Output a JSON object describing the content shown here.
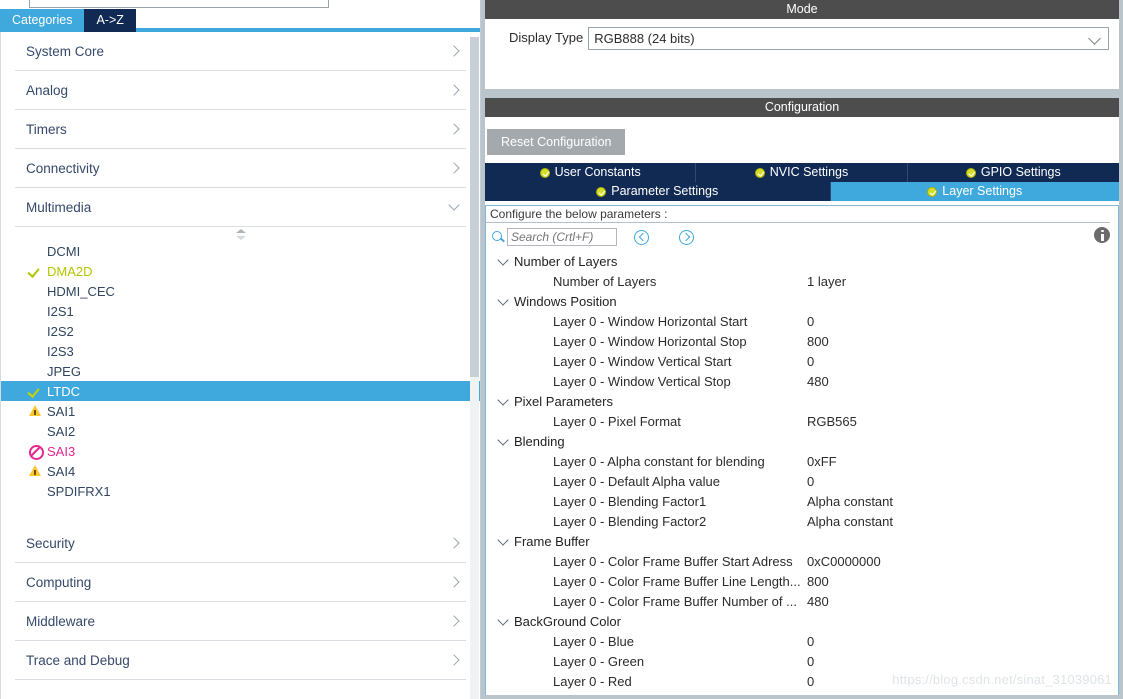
{
  "left_panel": {
    "search_box": {
      "value": "",
      "placeholder": ""
    },
    "tabs": [
      {
        "label": "Categories",
        "active": true
      },
      {
        "label": "A->Z",
        "active": false
      }
    ],
    "categories": [
      {
        "label": "System Core",
        "expanded": false
      },
      {
        "label": "Analog",
        "expanded": false
      },
      {
        "label": "Timers",
        "expanded": false
      },
      {
        "label": "Connectivity",
        "expanded": false
      },
      {
        "label": "Multimedia",
        "expanded": true
      }
    ],
    "peripherals": [
      {
        "label": "DCMI",
        "state": "none",
        "icon": "none"
      },
      {
        "label": "DMA2D",
        "state": "enabled",
        "icon": "check-icon"
      },
      {
        "label": "HDMI_CEC",
        "state": "none",
        "icon": "none"
      },
      {
        "label": "I2S1",
        "state": "none",
        "icon": "none"
      },
      {
        "label": "I2S2",
        "state": "none",
        "icon": "none"
      },
      {
        "label": "I2S3",
        "state": "none",
        "icon": "none"
      },
      {
        "label": "JPEG",
        "state": "none",
        "icon": "none"
      },
      {
        "label": "LTDC",
        "state": "selected",
        "icon": "check-icon"
      },
      {
        "label": "SAI1",
        "state": "warning",
        "icon": "warning-icon"
      },
      {
        "label": "SAI2",
        "state": "none",
        "icon": "none"
      },
      {
        "label": "SAI3",
        "state": "forbidden",
        "icon": "forbidden-icon"
      },
      {
        "label": "SAI4",
        "state": "warning",
        "icon": "warning-icon"
      },
      {
        "label": "SPDIFRX1",
        "state": "none",
        "icon": "none"
      }
    ],
    "categories_bottom": [
      {
        "label": "Security",
        "expanded": false
      },
      {
        "label": "Computing",
        "expanded": false
      },
      {
        "label": "Middleware",
        "expanded": false
      },
      {
        "label": "Trace and Debug",
        "expanded": false
      }
    ]
  },
  "right_panel": {
    "mode": {
      "header": "Mode",
      "display_type_label": "Display Type",
      "display_type_value": "RGB888 (24 bits)"
    },
    "configuration": {
      "header": "Configuration",
      "reset_button": "Reset Configuration",
      "tabs_row1": [
        {
          "label": "User Constants",
          "active": false
        },
        {
          "label": "NVIC Settings",
          "active": false
        },
        {
          "label": "GPIO Settings",
          "active": false
        }
      ],
      "tabs_row2": [
        {
          "label": "Parameter Settings",
          "active": false
        },
        {
          "label": "Layer Settings",
          "active": true
        }
      ],
      "hint": "Configure the below parameters :",
      "search": {
        "value": "",
        "placeholder": "Search (Crtl+F)"
      },
      "nav_prev": "previous-match",
      "nav_next": "next-match",
      "groups": [
        {
          "title": "Number of Layers",
          "params": [
            {
              "key": "Number of Layers",
              "value": "1 layer"
            }
          ]
        },
        {
          "title": "Windows Position",
          "params": [
            {
              "key": "Layer 0 - Window Horizontal Start",
              "value": "0"
            },
            {
              "key": "Layer 0 - Window Horizontal Stop",
              "value": "800"
            },
            {
              "key": "Layer 0 - Window Vertical Start",
              "value": "0"
            },
            {
              "key": "Layer 0 - Window Vertical Stop",
              "value": "480"
            }
          ]
        },
        {
          "title": "Pixel Parameters",
          "params": [
            {
              "key": "Layer 0 - Pixel Format",
              "value": "RGB565"
            }
          ]
        },
        {
          "title": "Blending",
          "params": [
            {
              "key": "Layer 0 - Alpha constant for blending",
              "value": "0xFF"
            },
            {
              "key": "Layer 0 - Default Alpha value",
              "value": "0"
            },
            {
              "key": "Layer 0 - Blending Factor1",
              "value": "Alpha constant"
            },
            {
              "key": "Layer 0 - Blending Factor2",
              "value": "Alpha constant"
            }
          ]
        },
        {
          "title": "Frame Buffer",
          "params": [
            {
              "key": "Layer 0 - Color Frame Buffer Start Adress",
              "value": "0xC0000000"
            },
            {
              "key": "Layer 0 - Color Frame Buffer Line Length...",
              "value": "800"
            },
            {
              "key": "Layer 0 - Color Frame Buffer Number of ...",
              "value": "480"
            }
          ]
        },
        {
          "title": "BackGround Color",
          "params": [
            {
              "key": "Layer 0 - Blue",
              "value": "0"
            },
            {
              "key": "Layer 0 - Green",
              "value": "0"
            },
            {
              "key": "Layer 0 - Red",
              "value": "0"
            }
          ]
        }
      ]
    },
    "watermark": "https://blog.csdn.net/sinat_31039061"
  },
  "colors": {
    "accent_blue": "#3fa9dd",
    "tab_dark_navy": "#102a54",
    "section_header_gray": "#4d4d4d",
    "panel_bg_gray": "#b9c4cb",
    "enabled_green": "#b5c400",
    "warning_yellow": "#fec72e",
    "forbidden_magenta": "#e8268f"
  }
}
